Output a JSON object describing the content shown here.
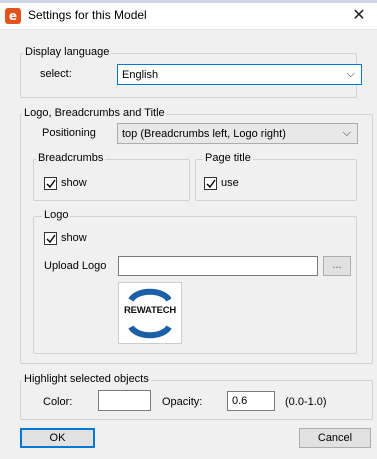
{
  "window": {
    "title": "Settings for this Model",
    "app_icon_glyph": "e",
    "close_glyph": "✕"
  },
  "display_language": {
    "legend": "Display language",
    "select_label": "select:",
    "selected": "English"
  },
  "logo_breadcrumbs_title": {
    "legend": "Logo, Breadcrumbs and Title",
    "positioning_label": "Positioning",
    "positioning_selected": "top (Breadcrumbs left, Logo right)",
    "breadcrumbs": {
      "legend": "Breadcrumbs",
      "checkbox_label": "show",
      "checked": true
    },
    "page_title": {
      "legend": "Page title",
      "checkbox_label": "use",
      "checked": true
    },
    "logo": {
      "legend": "Logo",
      "checkbox_label": "show",
      "checked": true,
      "upload_label": "Upload Logo",
      "upload_value": "",
      "browse_label": "...",
      "logo_text": "REWATECH",
      "logo_color": "#1a5fa8"
    }
  },
  "highlight": {
    "legend": "Highlight selected objects",
    "color_label": "Color:",
    "color_value": "",
    "opacity_label": "Opacity:",
    "opacity_value": "0.6",
    "opacity_range": "(0.0-1.0)"
  },
  "buttons": {
    "ok": "OK",
    "cancel": "Cancel"
  },
  "colors": {
    "accent": "#0078d7",
    "app_icon": "#e3541c"
  }
}
